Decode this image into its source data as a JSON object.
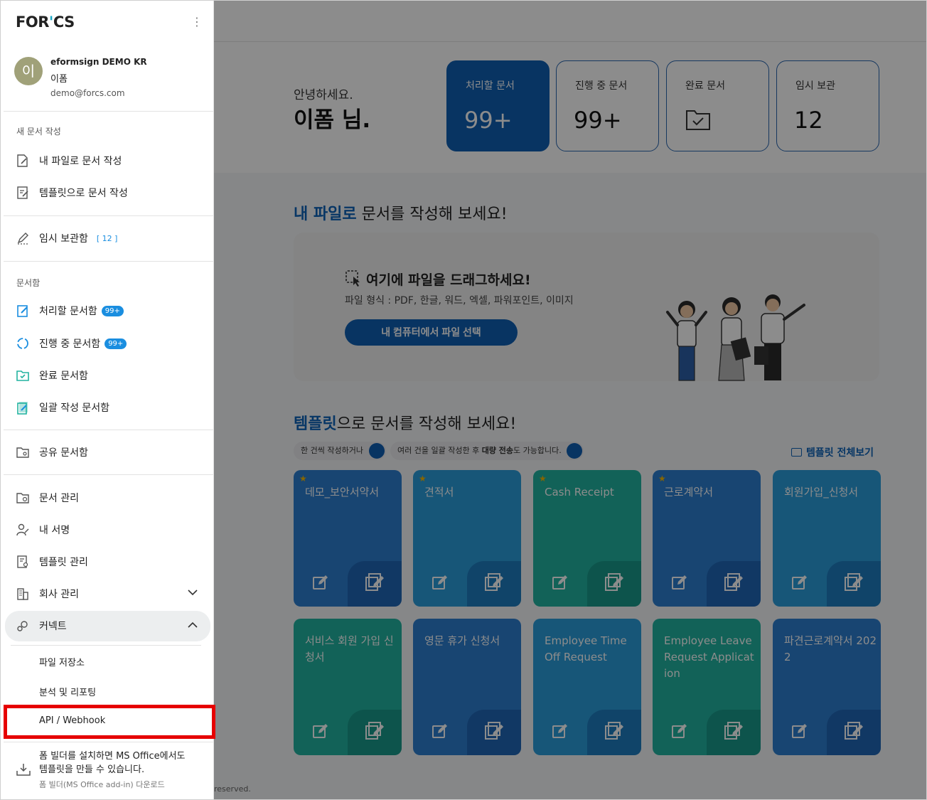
{
  "main": {
    "greeting_line1": "안녕하세요.",
    "greeting_line2": "이폼 님.",
    "stats": [
      {
        "label": "처리할 문서",
        "value": "99+"
      },
      {
        "label": "진행 중 문서",
        "value": "99+"
      },
      {
        "label": "완료 문서",
        "value": ""
      },
      {
        "label": "임시 보관",
        "value": "12"
      }
    ],
    "file_section": {
      "highlight": "내 파일로",
      "rest": " 문서를 작성해 보세요!"
    },
    "dropzone": {
      "title": "여기에 파일을 드래그하세요!",
      "formats": "파일 형식 : PDF, 한글, 워드, 엑셀, 파워포인트, 이미지",
      "button": "내 컴퓨터에서 파일 선택"
    },
    "template_section": {
      "highlight": "템플릿",
      "rest": "으로 문서를 작성해 보세요!"
    },
    "chip1": "한 건씩 작성하거나",
    "chip2_pre": "여러 건을 일괄 작성한 후 ",
    "chip2_bold": "대량 전송",
    "chip2_post": "도 가능합니다.",
    "view_all": "템플릿 전체보기",
    "footer": "reserved.",
    "templates": [
      {
        "name": "데모_보안서약서",
        "starred": true,
        "color": "blue"
      },
      {
        "name": "견적서",
        "starred": true,
        "color": "sky"
      },
      {
        "name": "Cash Receipt",
        "starred": true,
        "color": "teal"
      },
      {
        "name": "근로계약서",
        "starred": true,
        "color": "blue"
      },
      {
        "name": "회원가입_신청서",
        "starred": false,
        "color": "sky"
      },
      {
        "name": "서비스 회원 가입 신청서",
        "starred": false,
        "color": "teal"
      },
      {
        "name": "영문 휴가 신청서",
        "starred": false,
        "color": "blue"
      },
      {
        "name": "Employee Time Off Request",
        "starred": false,
        "color": "sky"
      },
      {
        "name": "Employee Leave Request Application",
        "starred": false,
        "color": "teal"
      },
      {
        "name": "파견근로계약서 2022",
        "starred": false,
        "color": "blue"
      }
    ]
  },
  "sidebar": {
    "logo_pre": "FOR",
    "logo_dot": "'",
    "logo_post": "CS",
    "user": {
      "initial": "이",
      "company": "eformsign DEMO KR",
      "name": "이폼",
      "email": "demo@forcs.com"
    },
    "group_new": "새 문서 작성",
    "new_from_file": "내 파일로 문서 작성",
    "new_from_template": "템플릿으로 문서 작성",
    "temp": "임시 보관함",
    "temp_count": "[ 12 ]",
    "group_box": "문서함",
    "box_todo": "처리할 문서함",
    "box_todo_badge": "99+",
    "box_progress": "진행 중 문서함",
    "box_progress_badge": "99+",
    "box_done": "완료 문서함",
    "box_bulk": "일괄 작성 문서함",
    "shared": "공유 문서함",
    "doc_manage": "문서 관리",
    "my_sign": "내 서명",
    "template_manage": "템플릿 관리",
    "company_manage": "회사 관리",
    "connect": "커넥트",
    "connect_sub": [
      "파일 저장소",
      "분석 및 리포팅",
      "API / Webhook"
    ],
    "promo_line1": "폼 빌더를 설치하면 MS Office에서도",
    "promo_line2": "템플릿을 만들 수 있습니다.",
    "promo_link": "폼 빌더(MS Office add-in) 다운로드"
  },
  "colors": {
    "primary": "#0f5fb3",
    "badge": "#1a8ee0",
    "highlight_box": "#e60000"
  }
}
